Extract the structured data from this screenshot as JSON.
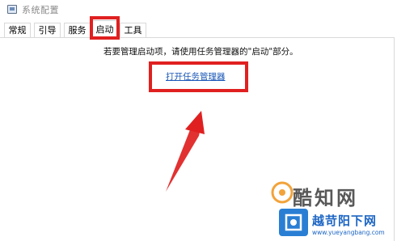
{
  "window": {
    "title": "系统配置"
  },
  "tabs": [
    {
      "label": "常规"
    },
    {
      "label": "引导"
    },
    {
      "label": "服务"
    },
    {
      "label": "启动"
    },
    {
      "label": "工具"
    }
  ],
  "active_tab": "启动",
  "startup": {
    "info_text": "若要管理启动项，请使用任务管理器的\"启动\"部分。",
    "link_label": "打开任务管理器"
  },
  "annotation": {
    "color": "#e02020"
  },
  "watermark": {
    "brand": "酷知网",
    "site_title": "越苛阳下网",
    "site_url": "www.yueyangbang.com"
  }
}
